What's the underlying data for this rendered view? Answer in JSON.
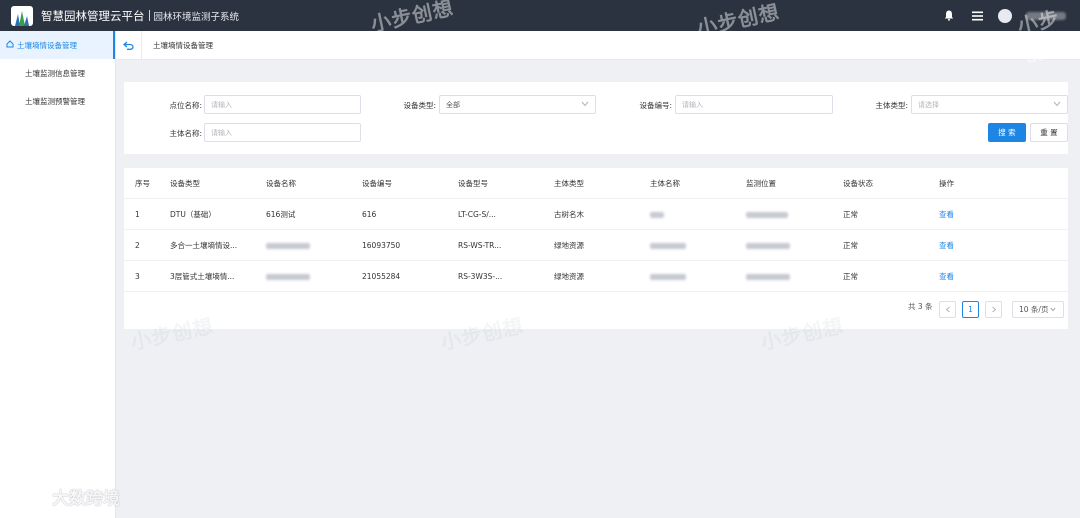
{
  "header": {
    "app_title": "智慧园林管理云平台",
    "sub_title": "园林环境监测子系统"
  },
  "sidebar": {
    "items": [
      {
        "label": "土壤墒情设备管理",
        "active": true
      },
      {
        "label": "土壤监测信息管理",
        "active": false
      },
      {
        "label": "土壤监测预警管理",
        "active": false
      }
    ]
  },
  "breadcrumb": "土壤墒情设备管理",
  "filters": {
    "site_name": {
      "label": "点位名称:",
      "placeholder": "请输入"
    },
    "device_type": {
      "label": "设备类型:",
      "value": "全部"
    },
    "device_code": {
      "label": "设备编号:",
      "placeholder": "请输入"
    },
    "subject_type": {
      "label": "主体类型:",
      "placeholder": "请选择"
    },
    "subject_name": {
      "label": "主体名称:",
      "placeholder": "请输入"
    },
    "search_label": "搜 索",
    "reset_label": "重 置"
  },
  "table": {
    "columns": [
      "序号",
      "设备类型",
      "设备名称",
      "设备编号",
      "设备型号",
      "主体类型",
      "主体名称",
      "监测位置",
      "设备状态",
      "操作"
    ],
    "rows": [
      {
        "index": "1",
        "type": "DTU（基础）",
        "name": "616测试",
        "code": "616",
        "model": "LT-CG-S/...",
        "subject_type": "古树名木",
        "status": "正常",
        "action": "查看"
      },
      {
        "index": "2",
        "type": "多合一土壤墒情设...",
        "name": "",
        "code": "16093750",
        "model": "RS-WS-TR...",
        "subject_type": "绿地资源",
        "status": "正常",
        "action": "查看"
      },
      {
        "index": "3",
        "type": "3层管式土壤墒情...",
        "name": "",
        "code": "21055284",
        "model": "RS-3W3S-...",
        "subject_type": "绿地资源",
        "status": "正常",
        "action": "查看"
      }
    ]
  },
  "pager": {
    "total": "共 3 条",
    "current": "1",
    "page_size": "10 条/页"
  },
  "watermarks": {
    "brand": "小步创想",
    "bottom": "大数跨境"
  },
  "colors": {
    "accent": "#1d86e4",
    "header_bg": "#2b3340",
    "page_bg": "#eef0f4"
  }
}
